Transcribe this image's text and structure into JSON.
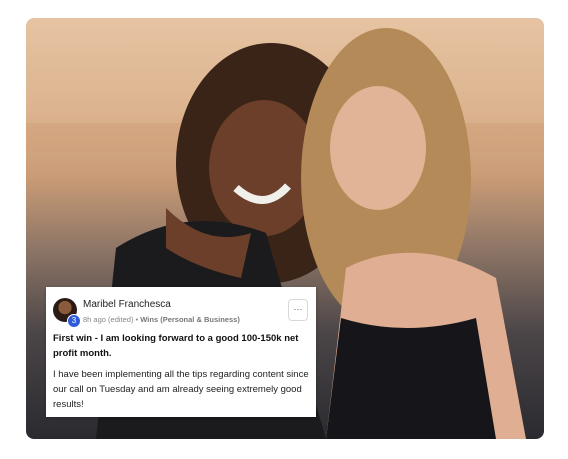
{
  "post": {
    "author": "Maribel Franchesca",
    "avatar_badge": "3",
    "time": "8h ago (edited)",
    "separator": "•",
    "category": "Wins (Personal & Business)",
    "more_icon": "ellipsis-icon",
    "more_label": "···",
    "title": "First win - I am looking forward to a good 100-150k net profit month.",
    "body": "I have been implementing all the tips regarding content since our call on Tuesday and am already seeing extremely good results!"
  },
  "colors": {
    "badge": "#2f5bd8",
    "card_bg": "#ffffff"
  }
}
